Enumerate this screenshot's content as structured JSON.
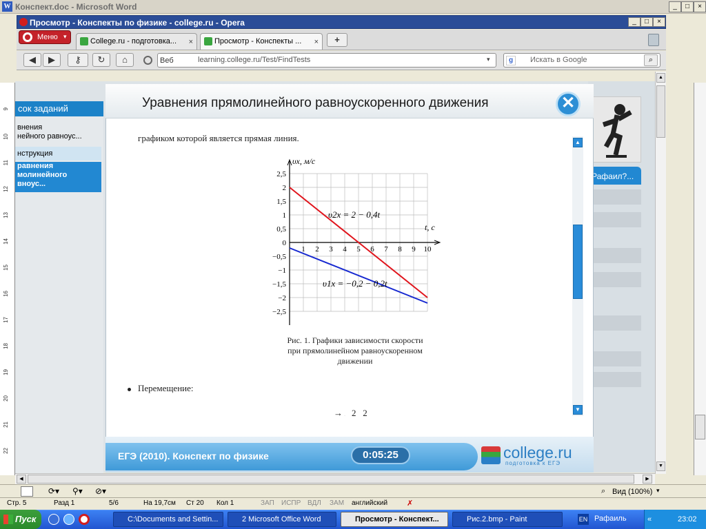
{
  "word": {
    "title": "Конспект.doc - Microsoft Word",
    "min": "_",
    "max": "□",
    "close": "×"
  },
  "opera": {
    "title": "Просмотр - Конспекты по физике - college.ru - Opera",
    "menu": "Меню"
  },
  "tabs": [
    {
      "label": "College.ru - подготовка...",
      "close": "×"
    },
    {
      "label": "Просмотр - Конспекты ...",
      "close": "×"
    }
  ],
  "address": {
    "scheme": "Веб",
    "url": "learning.college.ru/Test/FindTests",
    "search_placeholder": "Искать в Google"
  },
  "sidebar": {
    "header": "сок заданий",
    "items": [
      "внения\nнейного равноус...",
      "нструкция",
      "равнения\nмолинейного\nвноус..."
    ]
  },
  "modal": {
    "title": "Уравнения прямолинейного равноускоренного движения",
    "intro": "графиком которой является прямая линия.",
    "caption": "Рис. 1. Графики зависимости скорости\nпри прямолинейном равноускоренном\nдвижении",
    "bullet": "Перемещение:",
    "formula_partial": "→ ̧   2   2"
  },
  "chart_data": {
    "type": "line",
    "xlabel": "t, с",
    "ylabel": "υx, м/с",
    "xlim": [
      0,
      10
    ],
    "ylim": [
      -2.5,
      2.5
    ],
    "x_ticks": [
      "0",
      "1",
      "2",
      "3",
      "4",
      "5",
      "6",
      "7",
      "8",
      "9",
      "10"
    ],
    "y_ticks": [
      "2,5",
      "2",
      "1,5",
      "1",
      "0,5",
      "0",
      "−0,5",
      "−1",
      "−1,5",
      "−2",
      "−2,5"
    ],
    "series": [
      {
        "name": "υ2x = 2 − 0,4t",
        "color": "#e0141c",
        "x": [
          0,
          10
        ],
        "y": [
          2,
          -2
        ]
      },
      {
        "name": "υ1x = −0,2 − 0,2t",
        "color": "#1628d0",
        "x": [
          0,
          10
        ],
        "y": [
          -0.2,
          -2.2
        ]
      }
    ],
    "grid": true
  },
  "footer": {
    "course": "ЕГЭ (2010). Конспект по физике",
    "timer": "0:05:25",
    "logo": "college.ru",
    "logo_sub": "подготовка к ЕГЭ"
  },
  "right_panel": {
    "name": "Рафаил?..."
  },
  "word_status": {
    "page": "Стр. 5",
    "section": "Разд 1",
    "pages": "5/6",
    "at": "На 19,7см",
    "line": "Ст 20",
    "col": "Кол 1",
    "rec": "ЗАП",
    "trk": "ИСПР",
    "ext": "ВДЛ",
    "ovr": "ЗАМ",
    "lang": "английский",
    "zoom": "Вид (100%)"
  },
  "taskbar": {
    "start": "Пуск",
    "tasks": [
      "C:\\Documents and Settin...",
      "2 Microsoft Office Word",
      "Просмотр - Конспект...",
      "Рис.2.bmp - Paint"
    ],
    "lang": "EN",
    "user": "Рафаиль",
    "time": "23:02"
  },
  "ruler": [
    "9",
    "10",
    "11",
    "12",
    "13",
    "14",
    "15",
    "16",
    "17",
    "18",
    "19",
    "20",
    "21",
    "22"
  ]
}
